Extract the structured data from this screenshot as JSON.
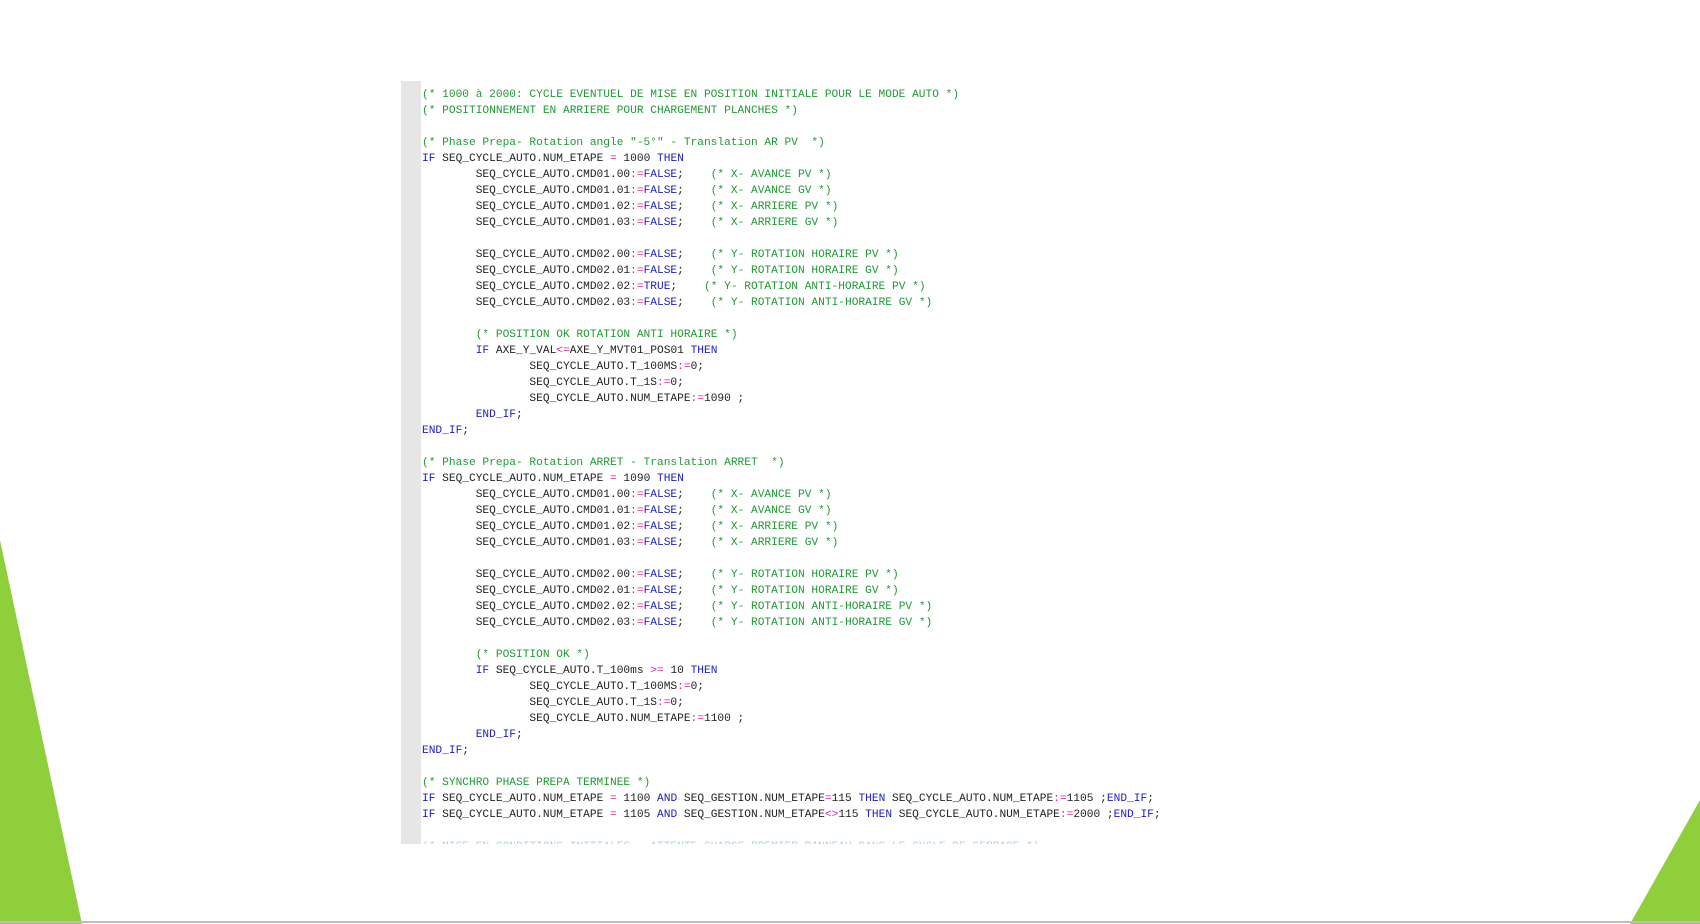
{
  "theme": {
    "keyword_color": "#1d1dbf",
    "comment_color": "#1e9a33",
    "operator_color": "#e0209d",
    "text_color": "#222222",
    "accent_green": "#8fcf3c",
    "gutter_color": "#e6e6e6"
  },
  "code_lines": [
    [
      [
        "cm",
        "(* 1000 à 2000: CYCLE EVENTUEL DE MISE EN POSITION INITIALE POUR LE MODE AUTO *)"
      ]
    ],
    [
      [
        "cm",
        "(* POSITIONNEMENT EN ARRIERE POUR CHARGEMENT PLANCHES *)"
      ]
    ],
    [],
    [
      [
        "cm",
        "(* Phase Prepa- Rotation angle \"-5°\" - Translation AR PV  *)"
      ]
    ],
    [
      [
        "kw",
        "IF"
      ],
      [
        "tx",
        " SEQ_CYCLE_AUTO.NUM_ETAPE "
      ],
      [
        "op",
        "="
      ],
      [
        "tx",
        " 1000 "
      ],
      [
        "kw",
        "THEN"
      ]
    ],
    [
      [
        "tx",
        "        SEQ_CYCLE_AUTO.CMD01.00"
      ],
      [
        "op",
        ":="
      ],
      [
        "kw",
        "FALSE"
      ],
      [
        "tx",
        ";    "
      ],
      [
        "cm",
        "(* X- AVANCE PV *)"
      ]
    ],
    [
      [
        "tx",
        "        SEQ_CYCLE_AUTO.CMD01.01"
      ],
      [
        "op",
        ":="
      ],
      [
        "kw",
        "FALSE"
      ],
      [
        "tx",
        ";    "
      ],
      [
        "cm",
        "(* X- AVANCE GV *)"
      ]
    ],
    [
      [
        "tx",
        "        SEQ_CYCLE_AUTO.CMD01.02"
      ],
      [
        "op",
        ":="
      ],
      [
        "kw",
        "FALSE"
      ],
      [
        "tx",
        ";    "
      ],
      [
        "cm",
        "(* X- ARRIERE PV *)"
      ]
    ],
    [
      [
        "tx",
        "        SEQ_CYCLE_AUTO.CMD01.03"
      ],
      [
        "op",
        ":="
      ],
      [
        "kw",
        "FALSE"
      ],
      [
        "tx",
        ";    "
      ],
      [
        "cm",
        "(* X- ARRIERE GV *)"
      ]
    ],
    [],
    [
      [
        "tx",
        "        SEQ_CYCLE_AUTO.CMD02.00"
      ],
      [
        "op",
        ":="
      ],
      [
        "kw",
        "FALSE"
      ],
      [
        "tx",
        ";    "
      ],
      [
        "cm",
        "(* Y- ROTATION HORAIRE PV *)"
      ]
    ],
    [
      [
        "tx",
        "        SEQ_CYCLE_AUTO.CMD02.01"
      ],
      [
        "op",
        ":="
      ],
      [
        "kw",
        "FALSE"
      ],
      [
        "tx",
        ";    "
      ],
      [
        "cm",
        "(* Y- ROTATION HORAIRE GV *)"
      ]
    ],
    [
      [
        "tx",
        "        SEQ_CYCLE_AUTO.CMD02.02"
      ],
      [
        "op",
        ":="
      ],
      [
        "kw",
        "TRUE"
      ],
      [
        "tx",
        ";    "
      ],
      [
        "cm",
        "(* Y- ROTATION ANTI-HORAIRE PV *)"
      ]
    ],
    [
      [
        "tx",
        "        SEQ_CYCLE_AUTO.CMD02.03"
      ],
      [
        "op",
        ":="
      ],
      [
        "kw",
        "FALSE"
      ],
      [
        "tx",
        ";    "
      ],
      [
        "cm",
        "(* Y- ROTATION ANTI-HORAIRE GV *)"
      ]
    ],
    [],
    [
      [
        "tx",
        "        "
      ],
      [
        "cm",
        "(* POSITION OK ROTATION ANTI HORAIRE *)"
      ]
    ],
    [
      [
        "tx",
        "        "
      ],
      [
        "kw",
        "IF"
      ],
      [
        "tx",
        " AXE_Y_VAL"
      ],
      [
        "op",
        "<="
      ],
      [
        "tx",
        "AXE_Y_MVT01_POS01 "
      ],
      [
        "kw",
        "THEN"
      ]
    ],
    [
      [
        "tx",
        "                SEQ_CYCLE_AUTO.T_100MS"
      ],
      [
        "op",
        ":="
      ],
      [
        "tx",
        "0;"
      ]
    ],
    [
      [
        "tx",
        "                SEQ_CYCLE_AUTO.T_1S"
      ],
      [
        "op",
        ":="
      ],
      [
        "tx",
        "0;"
      ]
    ],
    [
      [
        "tx",
        "                SEQ_CYCLE_AUTO.NUM_ETAPE"
      ],
      [
        "op",
        ":="
      ],
      [
        "tx",
        "1090 ;"
      ]
    ],
    [
      [
        "tx",
        "        "
      ],
      [
        "kw",
        "END_IF"
      ],
      [
        "tx",
        ";"
      ]
    ],
    [
      [
        "kw",
        "END_IF"
      ],
      [
        "tx",
        ";"
      ]
    ],
    [],
    [
      [
        "cm",
        "(* Phase Prepa- Rotation ARRET - Translation ARRET  *)"
      ]
    ],
    [
      [
        "kw",
        "IF"
      ],
      [
        "tx",
        " SEQ_CYCLE_AUTO.NUM_ETAPE "
      ],
      [
        "op",
        "="
      ],
      [
        "tx",
        " 1090 "
      ],
      [
        "kw",
        "THEN"
      ]
    ],
    [
      [
        "tx",
        "        SEQ_CYCLE_AUTO.CMD01.00"
      ],
      [
        "op",
        ":="
      ],
      [
        "kw",
        "FALSE"
      ],
      [
        "tx",
        ";    "
      ],
      [
        "cm",
        "(* X- AVANCE PV *)"
      ]
    ],
    [
      [
        "tx",
        "        SEQ_CYCLE_AUTO.CMD01.01"
      ],
      [
        "op",
        ":="
      ],
      [
        "kw",
        "FALSE"
      ],
      [
        "tx",
        ";    "
      ],
      [
        "cm",
        "(* X- AVANCE GV *)"
      ]
    ],
    [
      [
        "tx",
        "        SEQ_CYCLE_AUTO.CMD01.02"
      ],
      [
        "op",
        ":="
      ],
      [
        "kw",
        "FALSE"
      ],
      [
        "tx",
        ";    "
      ],
      [
        "cm",
        "(* X- ARRIERE PV *)"
      ]
    ],
    [
      [
        "tx",
        "        SEQ_CYCLE_AUTO.CMD01.03"
      ],
      [
        "op",
        ":="
      ],
      [
        "kw",
        "FALSE"
      ],
      [
        "tx",
        ";    "
      ],
      [
        "cm",
        "(* X- ARRIERE GV *)"
      ]
    ],
    [],
    [
      [
        "tx",
        "        SEQ_CYCLE_AUTO.CMD02.00"
      ],
      [
        "op",
        ":="
      ],
      [
        "kw",
        "FALSE"
      ],
      [
        "tx",
        ";    "
      ],
      [
        "cm",
        "(* Y- ROTATION HORAIRE PV *)"
      ]
    ],
    [
      [
        "tx",
        "        SEQ_CYCLE_AUTO.CMD02.01"
      ],
      [
        "op",
        ":="
      ],
      [
        "kw",
        "FALSE"
      ],
      [
        "tx",
        ";    "
      ],
      [
        "cm",
        "(* Y- ROTATION HORAIRE GV *)"
      ]
    ],
    [
      [
        "tx",
        "        SEQ_CYCLE_AUTO.CMD02.02"
      ],
      [
        "op",
        ":="
      ],
      [
        "kw",
        "FALSE"
      ],
      [
        "tx",
        ";    "
      ],
      [
        "cm",
        "(* Y- ROTATION ANTI-HORAIRE PV *)"
      ]
    ],
    [
      [
        "tx",
        "        SEQ_CYCLE_AUTO.CMD02.03"
      ],
      [
        "op",
        ":="
      ],
      [
        "kw",
        "FALSE"
      ],
      [
        "tx",
        ";    "
      ],
      [
        "cm",
        "(* Y- ROTATION ANTI-HORAIRE GV *)"
      ]
    ],
    [],
    [
      [
        "tx",
        "        "
      ],
      [
        "cm",
        "(* POSITION OK *)"
      ]
    ],
    [
      [
        "tx",
        "        "
      ],
      [
        "kw",
        "IF"
      ],
      [
        "tx",
        " SEQ_CYCLE_AUTO.T_100ms "
      ],
      [
        "op",
        ">="
      ],
      [
        "tx",
        " 10 "
      ],
      [
        "kw",
        "THEN"
      ]
    ],
    [
      [
        "tx",
        "                SEQ_CYCLE_AUTO.T_100MS"
      ],
      [
        "op",
        ":="
      ],
      [
        "tx",
        "0;"
      ]
    ],
    [
      [
        "tx",
        "                SEQ_CYCLE_AUTO.T_1S"
      ],
      [
        "op",
        ":="
      ],
      [
        "tx",
        "0;"
      ]
    ],
    [
      [
        "tx",
        "                SEQ_CYCLE_AUTO.NUM_ETAPE"
      ],
      [
        "op",
        ":="
      ],
      [
        "tx",
        "1100 ;"
      ]
    ],
    [
      [
        "tx",
        "        "
      ],
      [
        "kw",
        "END_IF"
      ],
      [
        "tx",
        ";"
      ]
    ],
    [
      [
        "kw",
        "END_IF"
      ],
      [
        "tx",
        ";"
      ]
    ],
    [],
    [
      [
        "cm",
        "(* SYNCHRO PHASE PREPA TERMINEE *)"
      ]
    ],
    [
      [
        "kw",
        "IF"
      ],
      [
        "tx",
        " SEQ_CYCLE_AUTO.NUM_ETAPE "
      ],
      [
        "op",
        "="
      ],
      [
        "tx",
        " 1100 "
      ],
      [
        "kw",
        "AND"
      ],
      [
        "tx",
        " SEQ_GESTION.NUM_ETAPE"
      ],
      [
        "op",
        "="
      ],
      [
        "tx",
        "115 "
      ],
      [
        "kw",
        "THEN"
      ],
      [
        "tx",
        " SEQ_CYCLE_AUTO.NUM_ETAPE"
      ],
      [
        "op",
        ":="
      ],
      [
        "tx",
        "1105 ;"
      ],
      [
        "kw",
        "END_IF"
      ],
      [
        "tx",
        ";"
      ]
    ],
    [
      [
        "kw",
        "IF"
      ],
      [
        "tx",
        " SEQ_CYCLE_AUTO.NUM_ETAPE "
      ],
      [
        "op",
        "="
      ],
      [
        "tx",
        " 1105 "
      ],
      [
        "kw",
        "AND"
      ],
      [
        "tx",
        " SEQ_GESTION.NUM_ETAPE"
      ],
      [
        "op",
        "<>"
      ],
      [
        "tx",
        "115 "
      ],
      [
        "kw",
        "THEN"
      ],
      [
        "tx",
        " SEQ_CYCLE_AUTO.NUM_ETAPE"
      ],
      [
        "op",
        ":="
      ],
      [
        "tx",
        "2000 ;"
      ],
      [
        "kw",
        "END_IF"
      ],
      [
        "tx",
        ";"
      ]
    ],
    [],
    [
      [
        "cm",
        "(* MISE EN CONDITIONS INITIALES - ATTENTE CHARGE PREMIER PANNEAU DANS LE CYCLE DE SERRAGE *)"
      ]
    ]
  ]
}
